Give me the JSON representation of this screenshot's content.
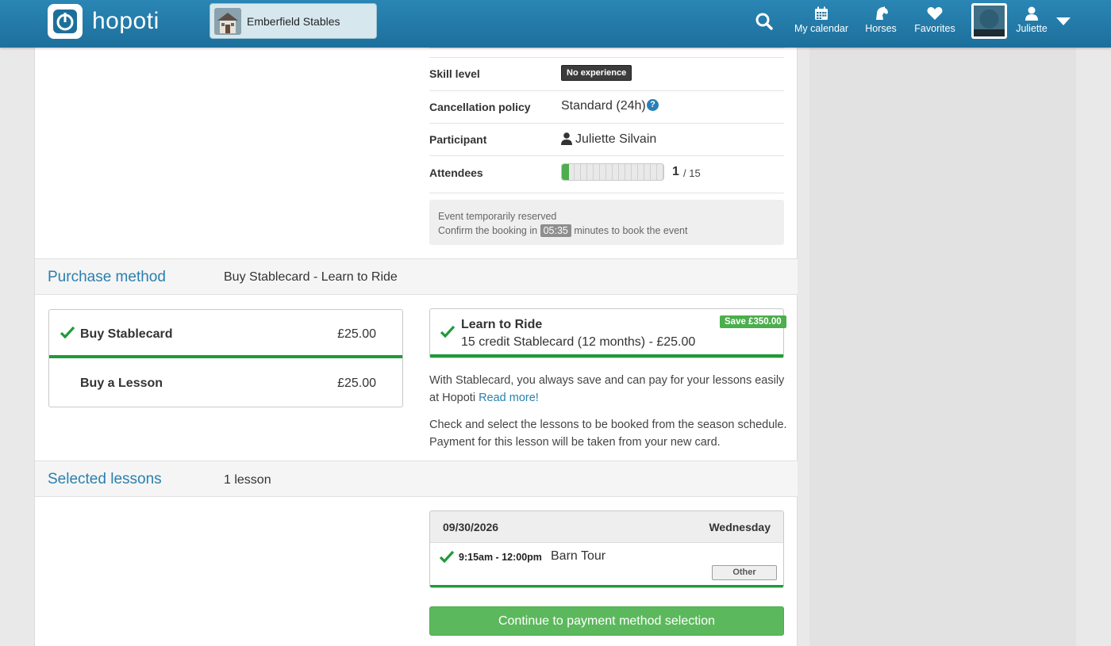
{
  "header": {
    "app_name": "hopoti",
    "stable_name": "Emberfield Stables",
    "nav": {
      "calendar": "My calendar",
      "horses": "Horses",
      "favorites": "Favorites",
      "user": "Juliette"
    }
  },
  "details": {
    "skill_label": "Skill level",
    "skill_value": "No experience",
    "cancel_label": "Cancellation policy",
    "cancel_value": "Standard (24h)",
    "cancel_help": "?",
    "participant_label": "Participant",
    "participant_value": "Juliette Silvain",
    "attendees_label": "Attendees",
    "attendees_count": "1",
    "attendees_total": "/ 15",
    "attendees_fill_fraction": 0.067
  },
  "reservation": {
    "line1": "Event temporarily reserved",
    "line2_prefix": "Confirm the booking in",
    "timer": "05:35",
    "line2_suffix": "minutes to book the event"
  },
  "purchase": {
    "section_title": "Purchase method",
    "section_value": "Buy Stablecard - Learn to Ride",
    "options": [
      {
        "label": "Buy Stablecard",
        "price": "£25.00",
        "selected": true
      },
      {
        "label": "Buy a Lesson",
        "price": "£25.00",
        "selected": false
      }
    ],
    "card": {
      "title": "Learn to Ride",
      "subtitle": "15 credit Stablecard (12 months) - £25.00",
      "save_badge": "Save £350.00"
    },
    "info1_text": "With Stablecard, you always save and can pay for your lessons easily at Hopoti",
    "info1_link": "Read more!",
    "info2_text": "Check and select the lessons to be booked from the season schedule. Payment for this lesson will be taken from your new card."
  },
  "lessons": {
    "section_title": "Selected lessons",
    "section_value": "1 lesson",
    "date": "09/30/2026",
    "day": "Wednesday",
    "time": "9:15am - 12:00pm",
    "name": "Barn Tour",
    "tag": "Other"
  },
  "cta": {
    "label": "Continue to payment method selection"
  },
  "colors": {
    "header_blue": "#2a86b5",
    "accent_blue": "#2a7fae",
    "success_green": "#5cb85c",
    "check_green": "#1f9a3a"
  }
}
